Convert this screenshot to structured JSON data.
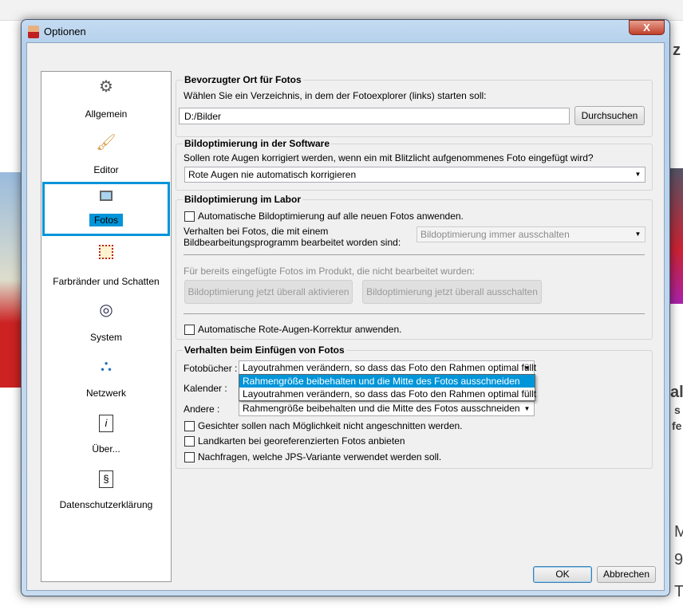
{
  "window": {
    "title": "Optionen",
    "close": "X"
  },
  "background": {
    "fragments": [
      "z",
      "al",
      "s",
      "fe",
      "M",
      "9",
      "T"
    ]
  },
  "sidebar": {
    "items": [
      {
        "label": "Allgemein",
        "icon": "gear-icon"
      },
      {
        "label": "Editor",
        "icon": "brush-icon"
      },
      {
        "label": "Fotos",
        "icon": "photo-icon"
      },
      {
        "label": "Farbränder und Schatten",
        "icon": "frame-icon"
      },
      {
        "label": "System",
        "icon": "system-icon"
      },
      {
        "label": "Netzwerk",
        "icon": "network-icon"
      },
      {
        "label": "Über...",
        "icon": "info-icon"
      },
      {
        "label": "Datenschutzerklärung",
        "icon": "privacy-icon"
      }
    ]
  },
  "groups": {
    "location": {
      "title": "Bevorzugter Ort für Fotos",
      "desc": "Wählen Sie ein Verzeichnis, in dem der Fotoexplorer (links) starten soll:",
      "path": "D:/Bilder",
      "browse": "Durchsuchen"
    },
    "software": {
      "title": "Bildoptimierung in der Software",
      "desc": "Sollen rote Augen korrigiert werden, wenn ein mit Blitzlicht aufgenommenes Foto eingefügt wird?",
      "select": "Rote Augen nie automatisch korrigieren"
    },
    "lab": {
      "title": "Bildoptimierung im Labor",
      "auto": "Automatische Bildoptimierung auf alle neuen Fotos anwenden.",
      "edited_line1": "Verhalten bei Fotos, die mit einem",
      "edited_line2": "Bildbearbeitungsprogramm bearbeitet worden sind:",
      "edited_select": "Bildoptimierung immer ausschalten",
      "existing": "Für bereits eingefügte Fotos im Produkt, die nicht bearbeitet wurden:",
      "activate": "Bildoptimierung jetzt überall aktivieren",
      "deactivate": "Bildoptimierung jetzt überall ausschalten",
      "redeye": "Automatische Rote-Augen-Korrektur anwenden."
    },
    "insert": {
      "title": "Verhalten beim Einfügen von Fotos",
      "fotobuecher_label": "Fotobücher :",
      "fotobuecher_value": "Layoutrahmen verändern, so dass das Foto den Rahmen optimal füllt",
      "kalender_label": "Kalender :",
      "andere_label": "Andere :",
      "andere_value": "Rahmengröße beibehalten und die Mitte des Fotos ausschneiden",
      "options": [
        "Rahmengröße beibehalten und die Mitte des Fotos ausschneiden",
        "Layoutrahmen verändern, so dass das Foto den Rahmen optimal füllt"
      ],
      "faces": "Gesichter sollen nach Möglichkeit nicht angeschnitten werden.",
      "maps": "Landkarten bei georeferenzierten Fotos anbieten",
      "jps": "Nachfragen, welche JPS-Variante verwendet werden soll."
    }
  },
  "footer": {
    "ok": "OK",
    "cancel": "Abbrechen"
  }
}
